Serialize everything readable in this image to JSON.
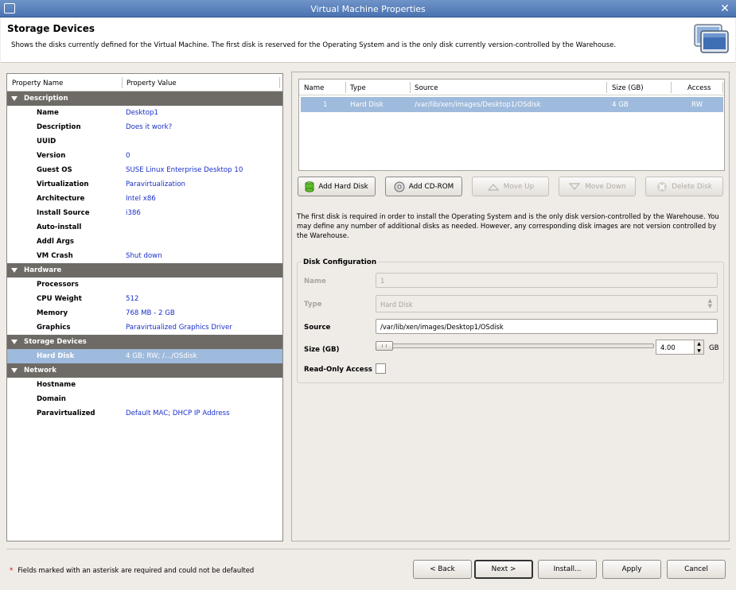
{
  "window": {
    "title": "Virtual Machine Properties"
  },
  "header": {
    "title": "Storage Devices",
    "description": "Shows the disks currently defined for the Virtual Machine.  The first disk is reserved for the Operating System and is the only disk currently version-controlled by the Warehouse."
  },
  "properties": {
    "col_name": "Property Name",
    "col_value": "Property Value",
    "rows": [
      {
        "type": "cat",
        "name": "Description"
      },
      {
        "name": "Name",
        "value": "Desktop1"
      },
      {
        "name": "Description",
        "value": "Does it work?"
      },
      {
        "name": "UUID",
        "value": ""
      },
      {
        "name": "Version",
        "value": "0"
      },
      {
        "name": "Guest OS",
        "value": "SUSE Linux Enterprise Desktop 10"
      },
      {
        "name": "Virtualization",
        "value": "Paravirtualization"
      },
      {
        "name": "Architecture",
        "value": "Intel x86"
      },
      {
        "name": "Install Source",
        "value": "i386"
      },
      {
        "name": "Auto-install",
        "value": ""
      },
      {
        "name": "Addl Args",
        "value": ""
      },
      {
        "name": "VM Crash",
        "value": "Shut down"
      },
      {
        "type": "cat",
        "name": "Hardware"
      },
      {
        "name": "Processors",
        "value": ""
      },
      {
        "name": "CPU Weight",
        "value": "512"
      },
      {
        "name": "Memory",
        "value": "768 MB - 2 GB"
      },
      {
        "name": "Graphics",
        "value": "Paravirtualized Graphics Driver"
      },
      {
        "type": "cat",
        "name": "Storage Devices"
      },
      {
        "name": "Hard Disk",
        "value": "4 GB; RW; /.../OSdisk",
        "selected": true
      },
      {
        "type": "cat",
        "name": "Network"
      },
      {
        "name": "Hostname",
        "value": ""
      },
      {
        "name": "Domain",
        "value": ""
      },
      {
        "name": "Paravirtualized",
        "value": "Default MAC; DHCP IP Address"
      }
    ]
  },
  "disks": {
    "columns": [
      "Name",
      "Type",
      "Source",
      "Size (GB)",
      "Access"
    ],
    "rows": [
      {
        "name": "1",
        "type": "Hard Disk",
        "source": "/var/lib/xen/images/Desktop1/OSdisk",
        "size": "4 GB",
        "access": "RW"
      }
    ]
  },
  "disk_buttons": {
    "add_hard_disk": "Add Hard Disk",
    "add_cdrom": "Add CD-ROM",
    "move_up": "Move Up",
    "move_down": "Move Down",
    "delete_disk": "Delete Disk"
  },
  "info_text": "The first disk is required in order to install the Operating System and is the only disk version-controlled by the Warehouse.  You may define any number of additional disks as needed.  However, any corresponding disk images are not version controlled by the Warehouse.",
  "disk_config": {
    "legend": "Disk Configuration",
    "name_label": "Name",
    "name_value": "1",
    "type_label": "Type",
    "type_value": "Hard Disk",
    "source_label": "Source",
    "source_value": "/var/lib/xen/images/Desktop1/OSdisk",
    "size_label": "Size (GB)",
    "size_value": "4.00",
    "size_unit": "GB",
    "readonly_label": "Read-Only Access"
  },
  "footer": {
    "asterisk": "*",
    "note": "Fields marked with an asterisk are required and could not be defaulted",
    "back": "< Back",
    "next": "Next >",
    "install": "Install...",
    "apply": "Apply",
    "cancel": "Cancel"
  },
  "colors": {
    "selection": "#9ebadc",
    "category": "#6e6b67",
    "value_text": "#1a2fc8",
    "titlebar": "#5a80bb"
  }
}
